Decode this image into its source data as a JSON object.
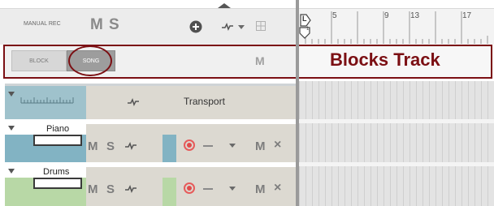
{
  "header": {
    "manual_rec_label": "MANUAL REC",
    "mute_label": "M",
    "solo_label": "S",
    "add_icon": "plus-circle-icon",
    "automation_icon": "automation-icon",
    "grid_icon": "grid-icon",
    "ruler": {
      "loop_marker": "L",
      "position_marker": "1",
      "bar_numbers": [
        "5",
        "9",
        "13",
        "17"
      ]
    }
  },
  "blocks_track": {
    "block_label": "BLOCK",
    "song_label": "SONG",
    "mute_label": "M",
    "title": "Blocks Track",
    "highlight_color": "#7b0f13"
  },
  "tracks": [
    {
      "name": "Transport",
      "color": "#9fc2cc",
      "automation_icon": "automation-icon"
    },
    {
      "name": "Piano",
      "color": "#82b3c3",
      "mute_label": "M",
      "solo_label": "S",
      "close_label": "×"
    },
    {
      "name": "Drums",
      "color": "#b8d8a6",
      "mute_label": "M",
      "solo_label": "S",
      "close_label": "×"
    }
  ]
}
